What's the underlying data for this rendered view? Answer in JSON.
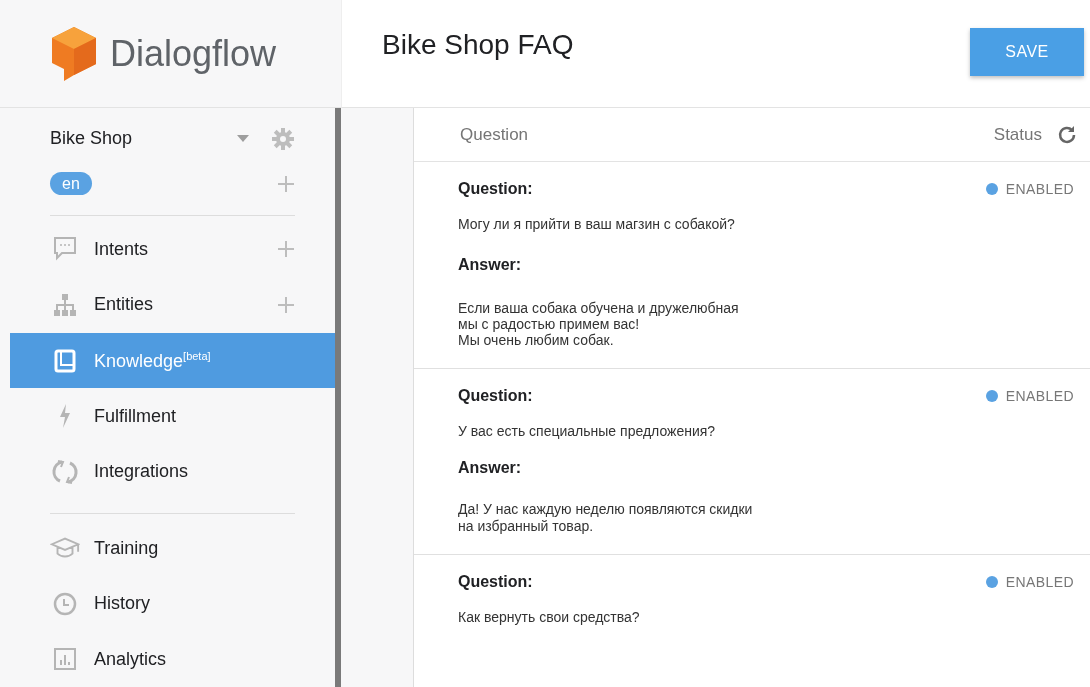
{
  "logo": {
    "text": "Dialogflow"
  },
  "agent": {
    "name": "Bike Shop",
    "language": "en"
  },
  "sidebar": {
    "groups": [
      [
        {
          "label": "Intents",
          "addable": true,
          "selected": false
        },
        {
          "label": "Entities",
          "addable": true,
          "selected": false
        },
        {
          "label": "Knowledge",
          "badge": "[beta]",
          "addable": false,
          "selected": true
        },
        {
          "label": "Fulfillment",
          "addable": false,
          "selected": false
        },
        {
          "label": "Integrations",
          "addable": false,
          "selected": false
        }
      ],
      [
        {
          "label": "Training",
          "addable": false,
          "selected": false
        },
        {
          "label": "History",
          "addable": false,
          "selected": false
        },
        {
          "label": "Analytics",
          "addable": false,
          "selected": false
        }
      ]
    ]
  },
  "page": {
    "title": "Bike Shop FAQ",
    "save_button": "SAVE"
  },
  "table": {
    "columns": [
      "Question",
      "Status"
    ],
    "rows": [
      {
        "question_label": "Question:",
        "question": "Могу ли я прийти в ваш магзин с собакой?",
        "answer_label": "Answer:",
        "answer": "Если ваша собака обучена и дружелюбная\nмы с радостью примем вас!\nМы очень любим собак.",
        "status": "ENABLED",
        "enabled": true
      },
      {
        "question_label": "Question:",
        "question": "У вас есть специальные предложения?",
        "answer_label": "Answer:",
        "answer": "Да! У нас каждую неделю появляются скидки\nна избранный товар.",
        "status": "ENABLED",
        "enabled": true
      },
      {
        "question_label": "Question:",
        "question": "Как вернуть свои средства?",
        "status": "ENABLED",
        "enabled": true
      }
    ]
  }
}
